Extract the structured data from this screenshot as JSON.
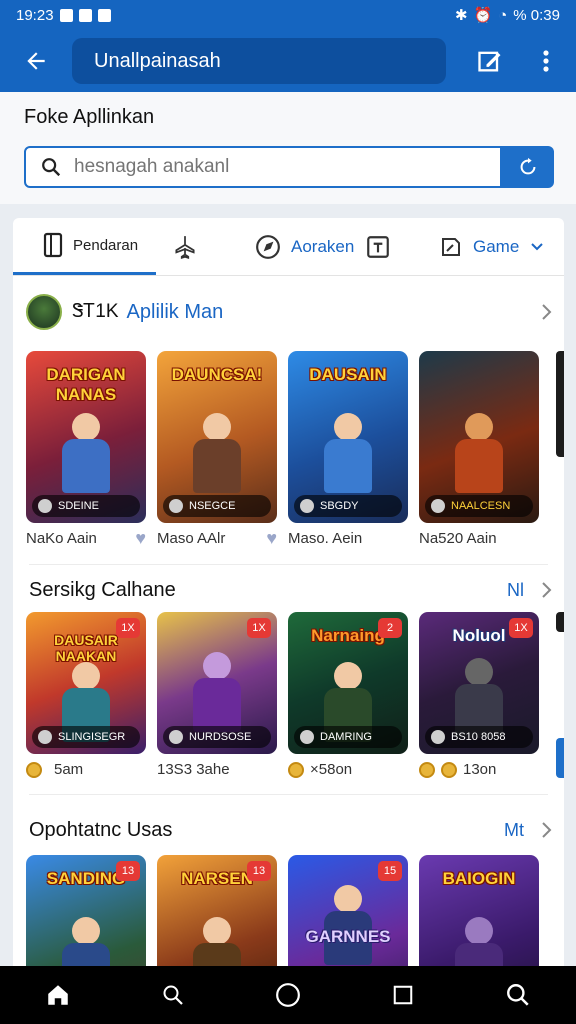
{
  "status_bar": {
    "time": "19:23",
    "right_text": "% 0:39"
  },
  "app_bar": {
    "title": "Unallpainasah"
  },
  "search_section": {
    "title": "Foke Apllinkan",
    "placeholder": "hesnagah anakanl"
  },
  "tabs": [
    {
      "label": "Pendaran",
      "icon": "tablet-icon",
      "active": true
    },
    {
      "label": "",
      "icon": "plane-icon",
      "active": false
    },
    {
      "label": "Aoraken",
      "icon": "compass-icon",
      "active": false
    },
    {
      "label": "",
      "icon": "box-icon",
      "active": false
    },
    {
      "label": "Game",
      "icon": "edit-icon",
      "active": false
    }
  ],
  "sections": [
    {
      "title": "Aplilik Man",
      "prefix": "ᏕᎢ1K",
      "more": "",
      "games": [
        {
          "title": "DARIGAN NANAS",
          "tag": "SDEINE",
          "caption": "NaKo Aain"
        },
        {
          "title": "DAUNCSA!",
          "tag": "NSEGCE",
          "caption": "Maso AAlr"
        },
        {
          "title": "DAUSAIN",
          "tag": "SBGDY",
          "caption": "Maso. Aein"
        },
        {
          "title": "",
          "tag": "NAALCESN",
          "caption": "Na520 Aain"
        }
      ]
    },
    {
      "title": "Sersikg Calhane",
      "more": "Nl",
      "games": [
        {
          "title": "DAUSAIR NAAKAN",
          "tag": "SLINGISEGR",
          "badge": "1X",
          "caption": "5am"
        },
        {
          "title": "",
          "tag": "NURDSOSE",
          "badge": "1X",
          "caption": "13S3 3ahe"
        },
        {
          "title": "Narnaing",
          "tag": "DAMRING",
          "badge": "2",
          "caption": "×58on"
        },
        {
          "title": "Noluol",
          "tag": "BS10 8058",
          "badge": "1X",
          "caption": "13on"
        }
      ]
    },
    {
      "title": "Opohtatnc Usas",
      "more": "Mt",
      "games": [
        {
          "title": "SANDING",
          "badge": "13"
        },
        {
          "title": "NARSEN",
          "badge": "13"
        },
        {
          "title": "GARNNES",
          "badge": "15"
        },
        {
          "title": "BAIOGIN",
          "badge": ""
        }
      ]
    }
  ],
  "colors": {
    "primary": "#1565c0",
    "accent": "#1e6fc9",
    "badge": "#e53935"
  }
}
